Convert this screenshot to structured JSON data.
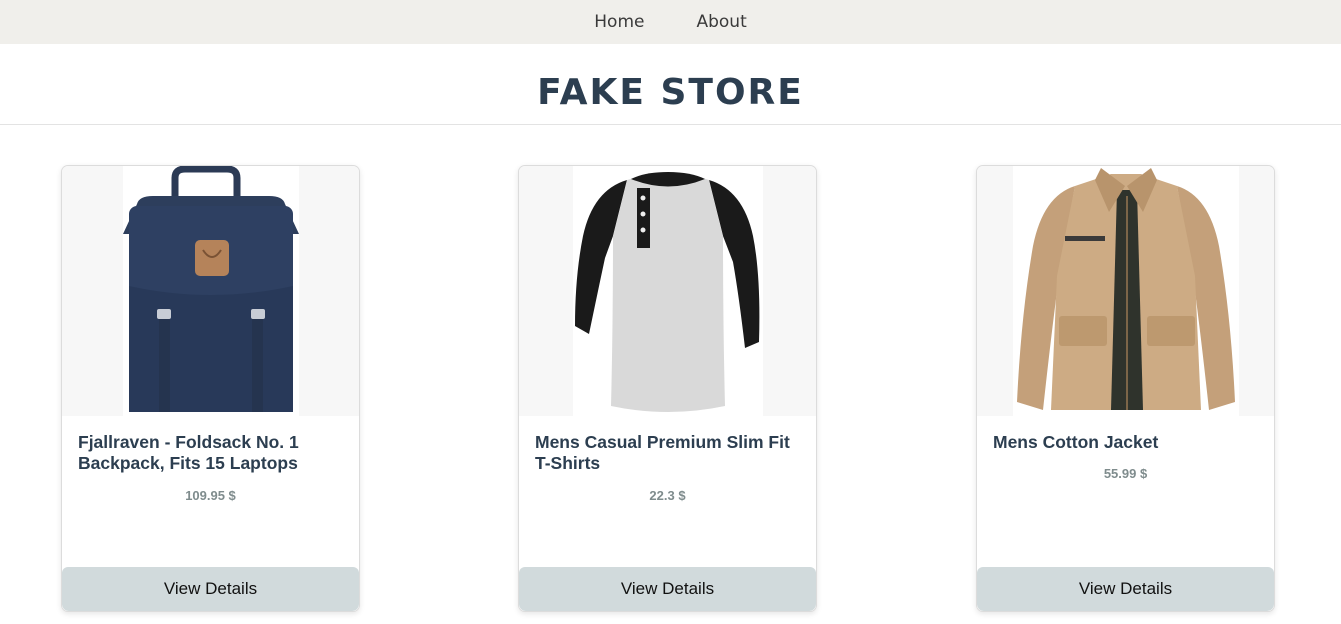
{
  "nav": {
    "home_label": "Home",
    "about_label": "About"
  },
  "header": {
    "title": "FAKE STORE"
  },
  "products": [
    {
      "title": "Fjallraven - Foldsack No. 1 Backpack, Fits 15 Laptops",
      "price": "109.95 $",
      "button": "View Details",
      "icon": "backpack-image"
    },
    {
      "title": "Mens Casual Premium Slim Fit T-Shirts",
      "price": "22.3 $",
      "button": "View Details",
      "icon": "tshirt-image"
    },
    {
      "title": "Mens Cotton Jacket",
      "price": "55.99 $",
      "button": "View Details",
      "icon": "jacket-image"
    }
  ],
  "colors": {
    "nav_bg": "#f0efeb",
    "title": "#2c3e50",
    "price": "#7f8c8d",
    "button_bg": "#d1dadc"
  }
}
